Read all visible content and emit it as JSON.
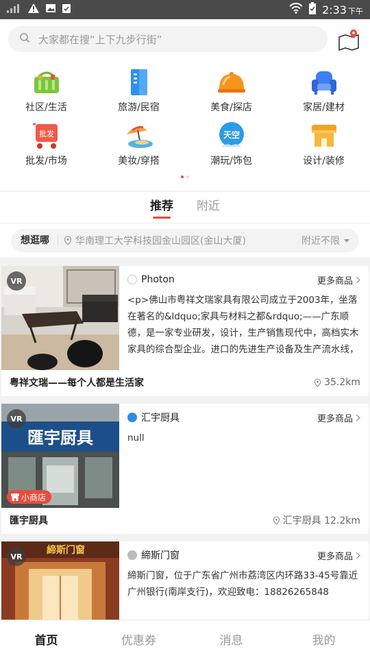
{
  "status_bar": {
    "time": "2:33",
    "ampm": "下午"
  },
  "search": {
    "placeholder": "大家都在搜“上下九步行街”"
  },
  "categories": [
    {
      "label": "社区/生活",
      "icon": "basket-icon"
    },
    {
      "label": "旅游/民宿",
      "icon": "building-icon"
    },
    {
      "label": "美食/探店",
      "icon": "food-cloche-icon"
    },
    {
      "label": "家居/建材",
      "icon": "sofa-icon"
    },
    {
      "label": "批发/市场",
      "icon": "wholesale-cart-icon",
      "badge": "批发"
    },
    {
      "label": "美妆/穿搭",
      "icon": "beach-umbrella-icon"
    },
    {
      "label": "潮玩/饰包",
      "icon": "tiankong-cloud-icon",
      "badge": "天空"
    },
    {
      "label": "设计/装修",
      "icon": "storefront-icon"
    }
  ],
  "tabs": [
    {
      "label": "推荐",
      "active": true
    },
    {
      "label": "附近",
      "active": false
    }
  ],
  "location_filter": {
    "label": "想逛哪",
    "address": "华南理工大学科技园金山园区(金山大厦)",
    "range": "附近不限"
  },
  "cards": [
    {
      "vr": "VR",
      "brand": "Photon",
      "more": "更多商品",
      "description": "<p>佛山市粤祥文瑞家具有限公司成立于2003年，坐落在著名的&ldquo;家具与材料之都&rdquo;——广东顺德，是一家专业研发，设计，生产销售现代中，高档实木家具的综合型企业。进口的先进生产设备及生产流水线，形成...",
      "shop_name": "粤祥文瑞——每个人都是生活家",
      "distance": "35.2km"
    },
    {
      "vr": "VR",
      "brand": "汇宇厨具",
      "more": "更多商品",
      "description": "null",
      "shop_name": "匯宇厨具",
      "distance": "汇宇厨具 12.2km",
      "badge": "小商店",
      "sign_text": "匯宇厨具"
    },
    {
      "vr": "VR",
      "brand": "締斯门窗",
      "more": "更多商品",
      "description": "締斯门窗，位于广东省广州市荔湾区内环路33-45号靠近广州银行(南岸支行)，欢迎致电：18826265848",
      "sign_text": "締斯门窗"
    }
  ],
  "bottom_nav": [
    {
      "label": "首页",
      "active": true
    },
    {
      "label": "优惠券",
      "active": false
    },
    {
      "label": "消息",
      "active": false
    },
    {
      "label": "我的",
      "active": false
    }
  ],
  "colors": {
    "accent": "#e94b3c",
    "status_bar": "#4a4a4a"
  }
}
